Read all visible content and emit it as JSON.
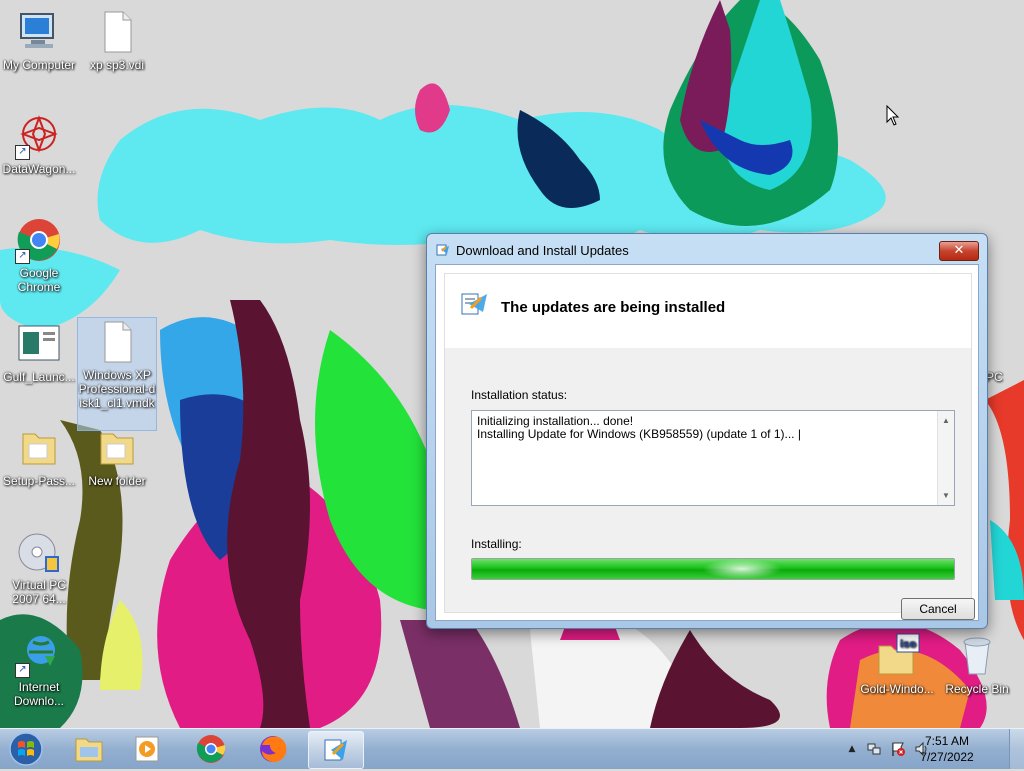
{
  "desktop": {
    "icons": [
      {
        "label": "My Computer"
      },
      {
        "label": "xp sp3.vdi"
      },
      {
        "label": "DataWagon..."
      },
      {
        "label": "Google Chrome"
      },
      {
        "label": "Gulf_Launc..."
      },
      {
        "label": "Windows XP Professional-disk1_cl1.vmdk"
      },
      {
        "label": "Setup-Pass..."
      },
      {
        "label": "New folder"
      },
      {
        "label": "Virtual PC 2007 64..."
      },
      {
        "label": "Internet Downlo..."
      },
      {
        "label": "Gold-Windo..."
      },
      {
        "label": "Recycle Bin"
      },
      {
        "label": "PC"
      }
    ]
  },
  "dialog": {
    "title": "Download and Install Updates",
    "close_label": "✕",
    "heading": "The updates are being installed",
    "status_label": "Installation status:",
    "log_lines": [
      "Initializing installation... done!",
      "Installing Update for Windows (KB958559) (update 1 of 1)... |"
    ],
    "installing_label": "Installing:",
    "progress_fraction": 1.0,
    "cancel_label": "Cancel"
  },
  "taskbar": {
    "clock_time": "7:51 AM",
    "clock_date": "7/27/2022",
    "tray_arrow": "▲"
  },
  "colors": {
    "progress_green": "#17c217",
    "taskbar": "#93afd0",
    "close_red": "#c7432d"
  }
}
